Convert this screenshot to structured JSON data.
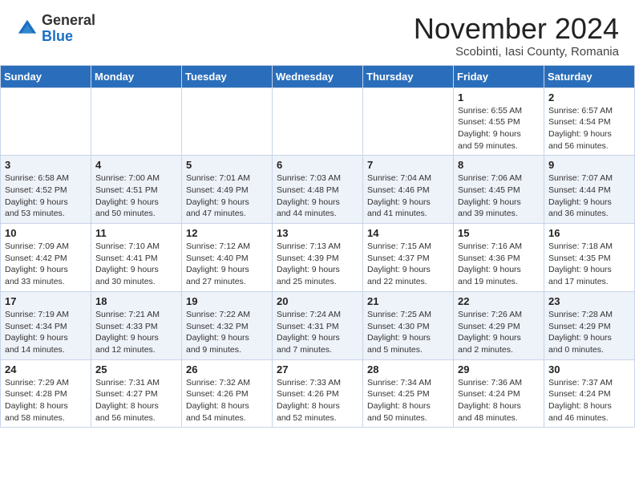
{
  "header": {
    "logo_general": "General",
    "logo_blue": "Blue",
    "month_title": "November 2024",
    "subtitle": "Scobinti, Iasi County, Romania"
  },
  "weekdays": [
    "Sunday",
    "Monday",
    "Tuesday",
    "Wednesday",
    "Thursday",
    "Friday",
    "Saturday"
  ],
  "weeks": [
    [
      {
        "day": "",
        "info": ""
      },
      {
        "day": "",
        "info": ""
      },
      {
        "day": "",
        "info": ""
      },
      {
        "day": "",
        "info": ""
      },
      {
        "day": "",
        "info": ""
      },
      {
        "day": "1",
        "info": "Sunrise: 6:55 AM\nSunset: 4:55 PM\nDaylight: 9 hours\nand 59 minutes."
      },
      {
        "day": "2",
        "info": "Sunrise: 6:57 AM\nSunset: 4:54 PM\nDaylight: 9 hours\nand 56 minutes."
      }
    ],
    [
      {
        "day": "3",
        "info": "Sunrise: 6:58 AM\nSunset: 4:52 PM\nDaylight: 9 hours\nand 53 minutes."
      },
      {
        "day": "4",
        "info": "Sunrise: 7:00 AM\nSunset: 4:51 PM\nDaylight: 9 hours\nand 50 minutes."
      },
      {
        "day": "5",
        "info": "Sunrise: 7:01 AM\nSunset: 4:49 PM\nDaylight: 9 hours\nand 47 minutes."
      },
      {
        "day": "6",
        "info": "Sunrise: 7:03 AM\nSunset: 4:48 PM\nDaylight: 9 hours\nand 44 minutes."
      },
      {
        "day": "7",
        "info": "Sunrise: 7:04 AM\nSunset: 4:46 PM\nDaylight: 9 hours\nand 41 minutes."
      },
      {
        "day": "8",
        "info": "Sunrise: 7:06 AM\nSunset: 4:45 PM\nDaylight: 9 hours\nand 39 minutes."
      },
      {
        "day": "9",
        "info": "Sunrise: 7:07 AM\nSunset: 4:44 PM\nDaylight: 9 hours\nand 36 minutes."
      }
    ],
    [
      {
        "day": "10",
        "info": "Sunrise: 7:09 AM\nSunset: 4:42 PM\nDaylight: 9 hours\nand 33 minutes."
      },
      {
        "day": "11",
        "info": "Sunrise: 7:10 AM\nSunset: 4:41 PM\nDaylight: 9 hours\nand 30 minutes."
      },
      {
        "day": "12",
        "info": "Sunrise: 7:12 AM\nSunset: 4:40 PM\nDaylight: 9 hours\nand 27 minutes."
      },
      {
        "day": "13",
        "info": "Sunrise: 7:13 AM\nSunset: 4:39 PM\nDaylight: 9 hours\nand 25 minutes."
      },
      {
        "day": "14",
        "info": "Sunrise: 7:15 AM\nSunset: 4:37 PM\nDaylight: 9 hours\nand 22 minutes."
      },
      {
        "day": "15",
        "info": "Sunrise: 7:16 AM\nSunset: 4:36 PM\nDaylight: 9 hours\nand 19 minutes."
      },
      {
        "day": "16",
        "info": "Sunrise: 7:18 AM\nSunset: 4:35 PM\nDaylight: 9 hours\nand 17 minutes."
      }
    ],
    [
      {
        "day": "17",
        "info": "Sunrise: 7:19 AM\nSunset: 4:34 PM\nDaylight: 9 hours\nand 14 minutes."
      },
      {
        "day": "18",
        "info": "Sunrise: 7:21 AM\nSunset: 4:33 PM\nDaylight: 9 hours\nand 12 minutes."
      },
      {
        "day": "19",
        "info": "Sunrise: 7:22 AM\nSunset: 4:32 PM\nDaylight: 9 hours\nand 9 minutes."
      },
      {
        "day": "20",
        "info": "Sunrise: 7:24 AM\nSunset: 4:31 PM\nDaylight: 9 hours\nand 7 minutes."
      },
      {
        "day": "21",
        "info": "Sunrise: 7:25 AM\nSunset: 4:30 PM\nDaylight: 9 hours\nand 5 minutes."
      },
      {
        "day": "22",
        "info": "Sunrise: 7:26 AM\nSunset: 4:29 PM\nDaylight: 9 hours\nand 2 minutes."
      },
      {
        "day": "23",
        "info": "Sunrise: 7:28 AM\nSunset: 4:29 PM\nDaylight: 9 hours\nand 0 minutes."
      }
    ],
    [
      {
        "day": "24",
        "info": "Sunrise: 7:29 AM\nSunset: 4:28 PM\nDaylight: 8 hours\nand 58 minutes."
      },
      {
        "day": "25",
        "info": "Sunrise: 7:31 AM\nSunset: 4:27 PM\nDaylight: 8 hours\nand 56 minutes."
      },
      {
        "day": "26",
        "info": "Sunrise: 7:32 AM\nSunset: 4:26 PM\nDaylight: 8 hours\nand 54 minutes."
      },
      {
        "day": "27",
        "info": "Sunrise: 7:33 AM\nSunset: 4:26 PM\nDaylight: 8 hours\nand 52 minutes."
      },
      {
        "day": "28",
        "info": "Sunrise: 7:34 AM\nSunset: 4:25 PM\nDaylight: 8 hours\nand 50 minutes."
      },
      {
        "day": "29",
        "info": "Sunrise: 7:36 AM\nSunset: 4:24 PM\nDaylight: 8 hours\nand 48 minutes."
      },
      {
        "day": "30",
        "info": "Sunrise: 7:37 AM\nSunset: 4:24 PM\nDaylight: 8 hours\nand 46 minutes."
      }
    ]
  ]
}
